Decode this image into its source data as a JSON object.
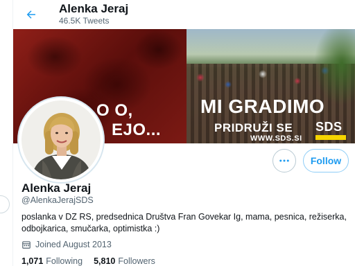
{
  "header": {
    "name": "Alenka Jeraj",
    "tweet_count": "46.5K Tweets"
  },
  "banner": {
    "left_line1": "O       O,",
    "left_line2": "EJO...",
    "title": "MI GRADIMO",
    "subtitle": "PRIDRUŽI SE",
    "brand": "SDS",
    "url": "WWW.SDS.SI"
  },
  "profile": {
    "display_name": "Alenka Jeraj",
    "handle": "@AlenkaJerajSDS",
    "bio": "poslanka v DZ RS, predsednica Društva Fran Govekar Ig, mama, pesnica, režiserka, odbojkarica, smučarka, optimistka :)",
    "joined": "Joined August 2013",
    "following_count": "1,071",
    "following_label": "Following",
    "followers_count": "5,810",
    "followers_label": "Followers"
  },
  "actions": {
    "follow_label": "Follow",
    "more_label": "•••"
  },
  "colors": {
    "accent": "#1d9bf0",
    "text": "#0f1419",
    "secondary": "#536471",
    "brand_yellow": "#f5d400"
  },
  "icons": {
    "back": "arrow-left-icon",
    "more": "more-icon",
    "calendar": "calendar-icon"
  }
}
